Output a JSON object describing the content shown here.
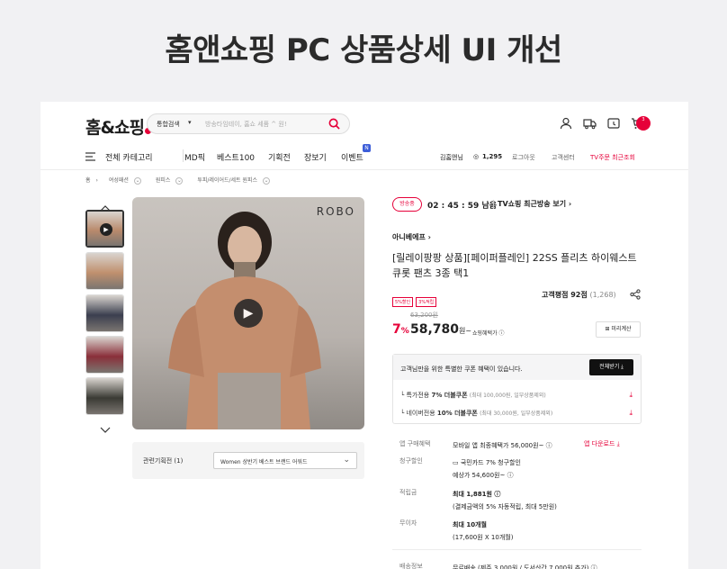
{
  "headline": "홈앤쇼핑  PC 상품상세 UI 개선",
  "header": {
    "logo": "홈&쇼핑",
    "search_category": "통합검색",
    "search_placeholder": "방송타임테이, 홈쇼 세품 ^ 원!",
    "cart_count": "3"
  },
  "nav": {
    "all_category": "전체 카테고리",
    "items": [
      "MD픽",
      "베스트100",
      "기획전",
      "장보기",
      "이벤트"
    ],
    "event_badge": "N",
    "user_name": "김홈앤님",
    "points": "1,295",
    "logout": "로그아웃",
    "customer_center": "고객센터",
    "tv_order": "TV주문 최근조회"
  },
  "breadcrumb": [
    "홈",
    "여성패션",
    "원피스",
    "투피/레이어드/세트 원피스"
  ],
  "gallery": {
    "brand_mark": "ROBO",
    "thumb_colors": [
      "#b98a6c",
      "#c0906e",
      "#3b3f4f",
      "#8a2f3a",
      "#3a3a34"
    ],
    "related_label": "관련기획전 (1)",
    "related_value": "Women 상반기 베스트 브랜드 어워드"
  },
  "broadcast": {
    "status": "방송중",
    "timer": "02 : 45 : 59 남음",
    "tv_link": "TV쇼핑 최근방송 보기 ›"
  },
  "product": {
    "seller": "아니베에프  ›",
    "title": "[릴레이팡팡 상품][페이퍼플레인] 22SS 플리츠 하이웨스트 큐롯 팬츠 3종 택1",
    "tags": [
      "5%할인",
      "3%적립"
    ],
    "rating_label": "고객평점 92점",
    "rating_count": "(1,268)",
    "original_price": "63,200원",
    "discount": "7",
    "discount_unit": "%",
    "price": "58,780",
    "price_unit": "원~",
    "benefit_text": "쇼핑혜택가 ⓘ",
    "calc_button": "미리계산"
  },
  "coupon": {
    "header": "고객님만을 위한 특별한 쿠폰 혜택이 있습니다.",
    "all_button": "전체받기",
    "rows": [
      {
        "label": "특가전용",
        "bold": "7% 더블쿠폰",
        "note": "(최대 100,000원, 일부상품제외)"
      },
      {
        "label": "네이버전용",
        "bold": "10% 더블쿠폰",
        "note": "(최대 30,000원, 일부상품제외)"
      }
    ]
  },
  "info": [
    {
      "key": "앱 구매혜택",
      "line1": "모바일 앱 최종혜택가 56,000원~ ⓘ",
      "extra": "앱 다운로드"
    },
    {
      "key": "청구할인",
      "line1": "국민카드 7% 청구할인",
      "line2": "예상가 54,600원~ ⓘ"
    },
    {
      "key": "적립금",
      "line1": "최대 1,881원 ⓘ",
      "line2": "(결제금액의 5% 자동적립, 최대 5만원)"
    },
    {
      "key": "무이자",
      "line1": "최대 10개월",
      "line2": "(17,600원 X 10개월)"
    },
    {
      "key": "배송정보",
      "line1": "무료배송 (제주 3,000원 / 도서산간 7,000원 추가) ⓘ"
    }
  ]
}
